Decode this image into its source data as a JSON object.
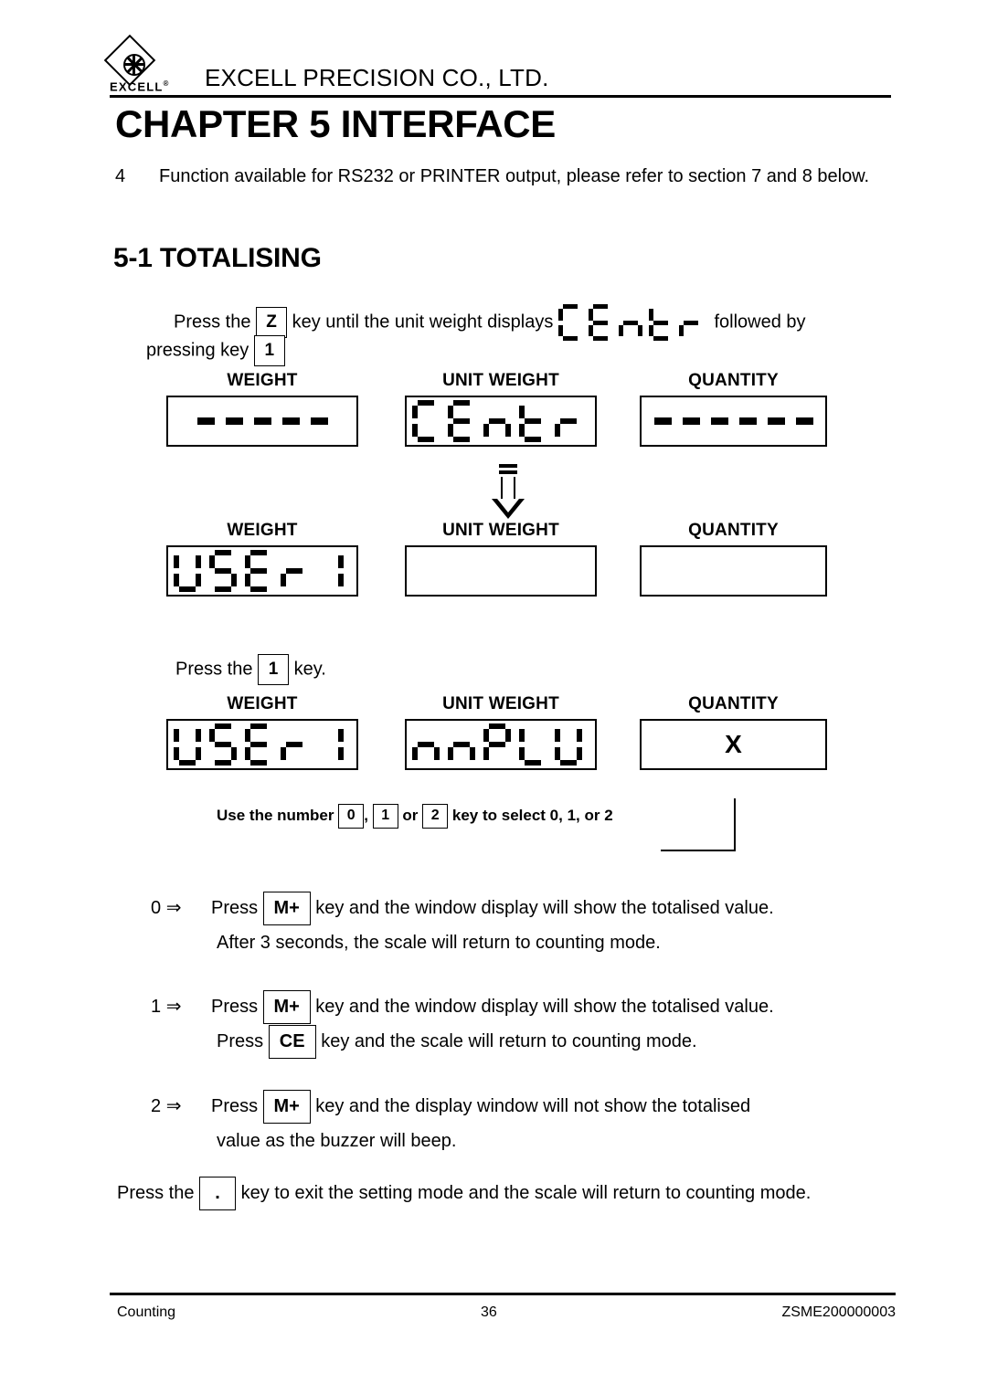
{
  "header": {
    "logo_text": "EXCELL",
    "logo_registered": "®",
    "company": "EXCELL PRECISION CO., LTD.",
    "chapter_title": "CHAPTER 5 INTERFACE"
  },
  "intro": {
    "number": "4",
    "text": "Function available for RS232 or PRINTER output, please refer to section 7 and 8 below."
  },
  "section": {
    "title": "5-1 TOTALISING"
  },
  "press_step1": {
    "line1_a": "Press the",
    "key_z": "Z",
    "line1_b": "key until the unit weight displays",
    "segments_inline": "CEntr",
    "line1_c": "followed by",
    "line2_a": "pressing key",
    "key_1": "1"
  },
  "display_rows": [
    {
      "columns": [
        {
          "label": "WEIGHT",
          "mode": "dashes",
          "dash_count": 5,
          "value": ""
        },
        {
          "label": "UNIT WEIGHT",
          "mode": "segments",
          "value": "CEntr"
        },
        {
          "label": "QUANTITY",
          "mode": "dashes",
          "dash_count": 6,
          "value": ""
        }
      ]
    },
    {
      "columns": [
        {
          "label": "WEIGHT",
          "mode": "segments",
          "value": "USEr1"
        },
        {
          "label": "UNIT WEIGHT",
          "mode": "blank",
          "value": ""
        },
        {
          "label": "QUANTITY",
          "mode": "blank",
          "value": ""
        }
      ]
    },
    {
      "columns": [
        {
          "label": "WEIGHT",
          "mode": "segments",
          "value": "USEr1"
        },
        {
          "label": "UNIT WEIGHT",
          "mode": "segments",
          "value": "nnPLU"
        },
        {
          "label": "QUANTITY",
          "mode": "text",
          "value": "X"
        }
      ]
    }
  ],
  "press_step2": {
    "prefix": "Press the",
    "key": "1",
    "suffix": "key."
  },
  "use_number_note": {
    "prefix": "Use the number",
    "key_0": "0",
    "comma": ",",
    "key_1": "1",
    "or": "or",
    "key_2": "2",
    "suffix": "key to select 0, 1, or 2"
  },
  "options": [
    {
      "number": "0",
      "arrow": "⇒",
      "press": "Press",
      "key": "M+",
      "text": "key and the window display will show the totalised value.",
      "sub": "After 3 seconds, the scale will return to counting mode."
    },
    {
      "number": "1",
      "arrow": "⇒",
      "press": "Press",
      "key": "M+",
      "text": "key and the window display will show the totalised value.",
      "sub_press": "Press",
      "sub_key": "CE",
      "sub_text": "key and the scale will return to counting mode."
    },
    {
      "number": "2",
      "arrow": "⇒",
      "press": "Press",
      "key": "M+",
      "text": "key and the display window will not show the totalised",
      "sub": "value as the buzzer will beep."
    }
  ],
  "final_line": {
    "prefix": "Press the",
    "key": ".",
    "suffix": "key to exit the setting mode and the scale will return to counting mode."
  },
  "footer": {
    "left": "Counting",
    "center": "36",
    "right": "ZSME200000003"
  }
}
